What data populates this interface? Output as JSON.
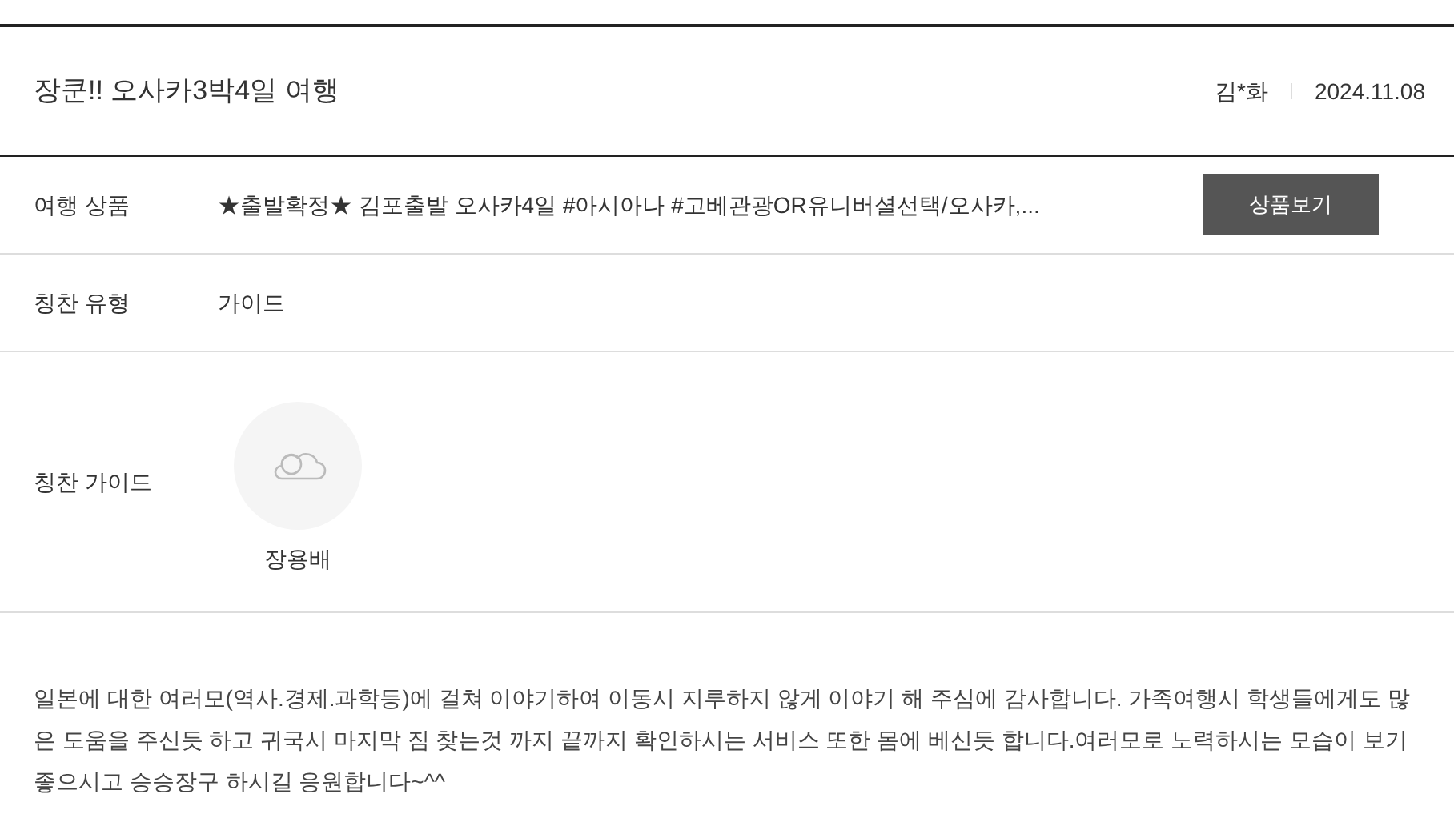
{
  "title": "장쿤!! 오사카3박4일 여행",
  "author": "김*화",
  "date": "2024.11.08",
  "rows": [
    {
      "label": "여행 상품",
      "value": "★출발확정★ 김포출발 오사카4일 #아시아나 #고베관광OR유니버셜선택/오사카,...",
      "button": "상품보기"
    },
    {
      "label": "칭찬 유형",
      "value": "가이드"
    }
  ],
  "guide": {
    "label": "칭찬 가이드",
    "name": "장용배"
  },
  "body": "일본에 대한 여러모(역사.경제.과학등)에 걸쳐 이야기하여 이동시 지루하지 않게 이야기 해 주심에 감사합니다. 가족여행시 학생들에게도 많은 도움을 주신듯 하고 귀국시 마지막 짐 찾는것 까지 끝까지 확인하시는 서비스 또한 몸에 베신듯 합니다.여러모로 노력하시는 모습이 보기좋으시고 승승장구 하시길 응원합니다~^^"
}
